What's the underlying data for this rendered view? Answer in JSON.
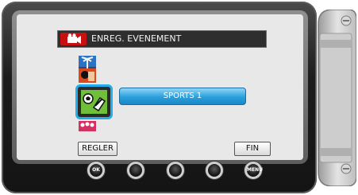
{
  "menu": {
    "title": "ENREG. EVENEMENT",
    "selected_value": "SPORTS 1",
    "items": [
      {
        "icon": "landscape-palm-icon"
      },
      {
        "icon": "portrait-icon"
      },
      {
        "icon": "soccer-kick-icon",
        "selected": true
      },
      {
        "icon": "crowd-icon"
      }
    ]
  },
  "softkeys": {
    "left": "REGLER",
    "right": "FIN"
  },
  "buttons": {
    "ok": "OK",
    "menu": "MENU"
  },
  "colors": {
    "header_icon_bg": "#c81010",
    "selection_border": "#22aeea",
    "value_bar": "#2a9fdc"
  }
}
